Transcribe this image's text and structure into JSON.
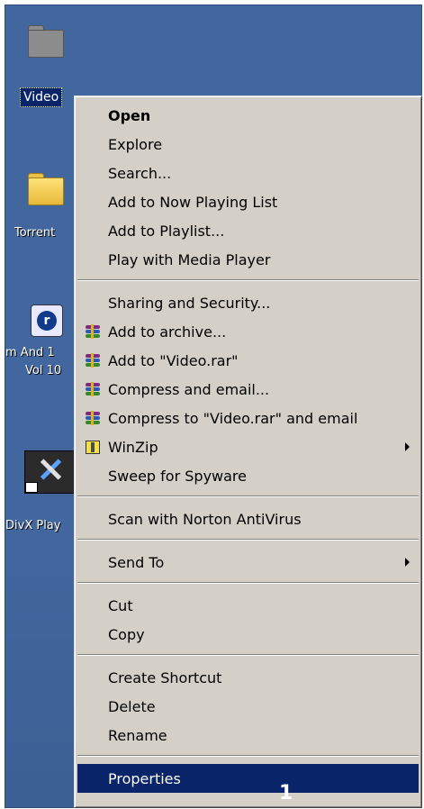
{
  "desktop": {
    "icons": [
      {
        "label": "Video"
      },
      {
        "label": "Torrent"
      },
      {
        "label": "m And 1"
      },
      {
        "label": "Vol 10"
      },
      {
        "label": "DivX Play"
      }
    ]
  },
  "context_menu": {
    "items": [
      {
        "label": "Open",
        "icon": ""
      },
      {
        "label": "Explore",
        "icon": ""
      },
      {
        "label": "Search...",
        "icon": ""
      },
      {
        "label": "Add to Now Playing List",
        "icon": ""
      },
      {
        "label": "Add to Playlist...",
        "icon": ""
      },
      {
        "label": "Play with Media Player",
        "icon": ""
      },
      {
        "label": "Sharing and Security...",
        "icon": ""
      },
      {
        "label": "Add to archive...",
        "icon": "winrar-icon"
      },
      {
        "label": "Add to \"Video.rar\"",
        "icon": "winrar-icon"
      },
      {
        "label": "Compress and email...",
        "icon": "winrar-icon"
      },
      {
        "label": "Compress to \"Video.rar\" and email",
        "icon": "winrar-icon"
      },
      {
        "label": "WinZip",
        "icon": "winzip-icon"
      },
      {
        "label": "Sweep for Spyware",
        "icon": ""
      },
      {
        "label": "Scan with Norton AntiVirus",
        "icon": ""
      },
      {
        "label": "Send To",
        "icon": ""
      },
      {
        "label": "Cut",
        "icon": ""
      },
      {
        "label": "Copy",
        "icon": ""
      },
      {
        "label": "Create Shortcut",
        "icon": ""
      },
      {
        "label": "Delete",
        "icon": ""
      },
      {
        "label": "Rename",
        "icon": ""
      },
      {
        "label": "Properties",
        "icon": ""
      }
    ],
    "selected_label": "Properties",
    "annotation": "1"
  },
  "colors": {
    "desktop": "#41679e",
    "menu_bg": "#d4d0c8",
    "selection": "#0a246a"
  }
}
